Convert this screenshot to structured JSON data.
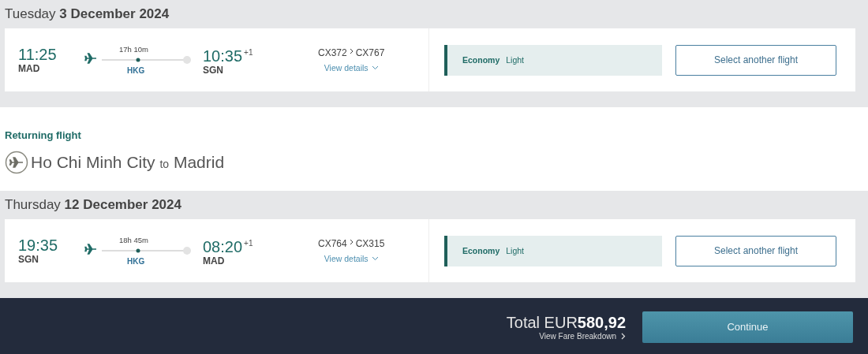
{
  "outbound": {
    "weekday": "Tuesday",
    "date": "3 December 2024",
    "flight": {
      "depart_time": "11:25",
      "depart_airport": "MAD",
      "duration": "17h 10m",
      "stop": "HKG",
      "arrive_time": "10:35",
      "day_offset": "+1",
      "arrive_airport": "SGN",
      "flight_numbers": [
        "CX372",
        "CX767"
      ],
      "details_link": "View details",
      "cabin": "Economy",
      "fare": "Light",
      "action": "Select another flight"
    }
  },
  "returning": {
    "label": "Returning flight",
    "from": "Ho Chi Minh City",
    "connector": "to",
    "to": "Madrid",
    "weekday": "Thursday",
    "date": "12 December 2024",
    "flight": {
      "depart_time": "19:35",
      "depart_airport": "SGN",
      "duration": "18h 45m",
      "stop": "HKG",
      "arrive_time": "08:20",
      "day_offset": "+1",
      "arrive_airport": "MAD",
      "flight_numbers": [
        "CX764",
        "CX315"
      ],
      "details_link": "View details",
      "cabin": "Economy",
      "fare": "Light",
      "action": "Select another flight"
    }
  },
  "footer": {
    "total_label": "Total EUR",
    "total_amount": "580,92",
    "breakdown_link": "View Fare Breakdown",
    "continue_button": "Continue"
  }
}
